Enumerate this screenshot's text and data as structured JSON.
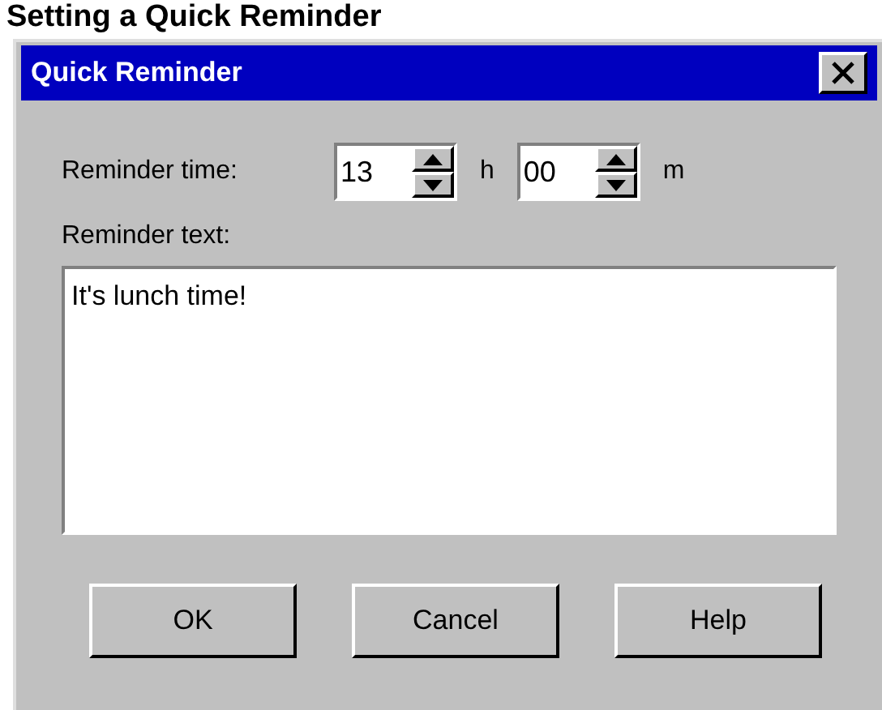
{
  "heading": "Setting a Quick Reminder",
  "window": {
    "title": "Quick Reminder"
  },
  "time": {
    "label": "Reminder time:",
    "hours": "13",
    "hours_unit": "h",
    "minutes": "00",
    "minutes_unit": "m"
  },
  "reminder_text": {
    "label": "Reminder text:",
    "value": "It's lunch time!"
  },
  "buttons": [
    "OK",
    "Cancel",
    "Help"
  ]
}
